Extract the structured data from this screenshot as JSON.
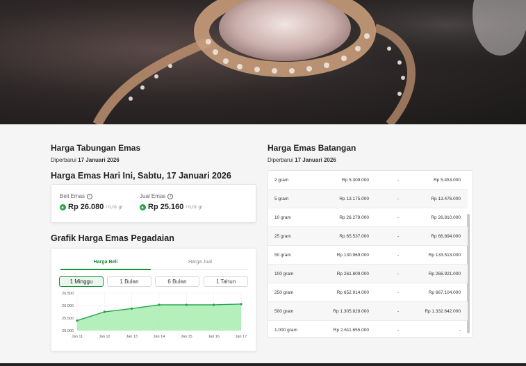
{
  "tabungan": {
    "title": "Harga Tabungan Emas",
    "updated_prefix": "Diperbarui",
    "updated_date": "17 Januari 2026",
    "today_title": "Harga Emas Hari Ini, Sabtu, 17 Januari 2026",
    "beli_label": "Beli Emas",
    "beli_value": "Rp 26.080",
    "beli_unit": "/ 0,01 gr",
    "jual_label": "Jual Emas",
    "jual_value": "Rp 25.160",
    "jual_unit": "/ 0,01 gr"
  },
  "grafik": {
    "title": "Grafik Harga Emas Pegadaian",
    "tabs": [
      "Harga Beli",
      "Harga Jual"
    ],
    "ranges": [
      "1 Minggu",
      "1 Bulan",
      "6 Bulan",
      "1 Tahun"
    ],
    "active_range": "1 Minggu",
    "accent": "#1fa34a"
  },
  "chart_data": {
    "type": "area",
    "x": [
      "Jan 11",
      "Jan 12",
      "Jan 13",
      "Jan 14",
      "Jan 15",
      "Jan 16",
      "Jan 17"
    ],
    "y_ticks": [
      "26.500",
      "26.000",
      "25.500",
      "25.000"
    ],
    "ylim": [
      25000,
      26500
    ],
    "series": [
      {
        "values": [
          25400,
          25750,
          25880,
          26030,
          26030,
          26030,
          26060
        ]
      }
    ],
    "grid": true
  },
  "batangan": {
    "title": "Harga Emas Batangan",
    "updated_prefix": "Diperbarui",
    "updated_date": "17 Januari 2026",
    "rows": [
      {
        "weight": "2 gram",
        "buy": "Rp 5.309.000",
        "dash": "-",
        "sell": "Rp 5.453.000"
      },
      {
        "weight": "5 gram",
        "buy": "Rp 13.175.000",
        "dash": "-",
        "sell": "Rp 13.476.000"
      },
      {
        "weight": "10 gram",
        "buy": "Rp 26.279.000",
        "dash": "-",
        "sell": "Rp 26.810.000"
      },
      {
        "weight": "25 gram",
        "buy": "Rp 65.537.000",
        "dash": "-",
        "sell": "Rp 66.894.000"
      },
      {
        "weight": "50 gram",
        "buy": "Rp 130.969.000",
        "dash": "-",
        "sell": "Rp 133.513.000"
      },
      {
        "weight": "100 gram",
        "buy": "Rp 261.809.000",
        "dash": "-",
        "sell": "Rp 266.921.000"
      },
      {
        "weight": "250 gram",
        "buy": "Rp 652.914.000",
        "dash": "-",
        "sell": "Rp 667.104.000"
      },
      {
        "weight": "500 gram",
        "buy": "Rp 1.305.828.000",
        "dash": "-",
        "sell": "Rp 1.332.642.000"
      },
      {
        "weight": "1.000 gram",
        "buy": "Rp 2.611.655.000",
        "dash": "-",
        "sell": "-"
      }
    ]
  }
}
